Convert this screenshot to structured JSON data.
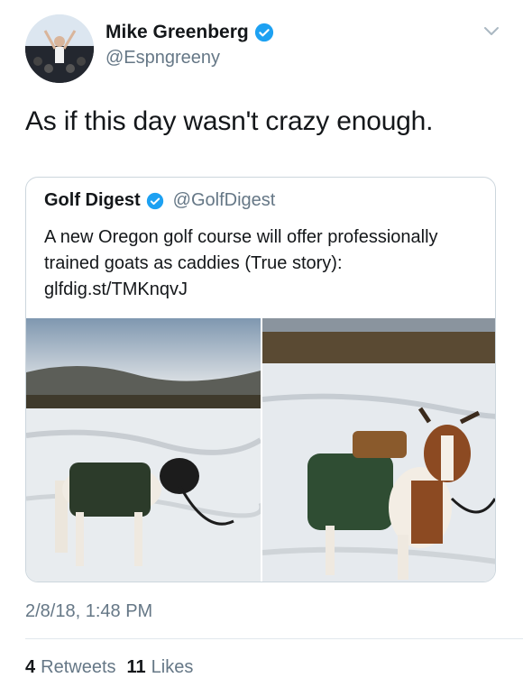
{
  "author": {
    "name": "Mike Greenberg",
    "handle": "@Espngreeny",
    "verified": true
  },
  "tweet": {
    "text": "As if this day wasn't crazy enough.",
    "timestamp": "2/8/18, 1:48 PM"
  },
  "quoted": {
    "name": "Golf Digest",
    "handle": "@GolfDigest",
    "verified": true,
    "text": "A new Oregon golf course will offer professionally trained goats as caddies (True story): glfdig.st/TMKnqvJ"
  },
  "stats": {
    "retweets_count": "4",
    "retweets_label": "Retweets",
    "likes_count": "11",
    "likes_label": "Likes"
  },
  "colors": {
    "verified": "#1da1f2",
    "secondary_text": "#657786",
    "border": "#ccd6dd"
  }
}
